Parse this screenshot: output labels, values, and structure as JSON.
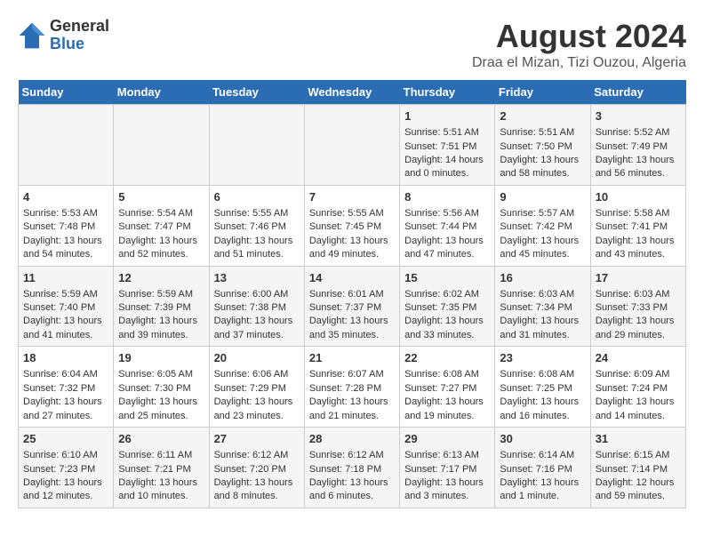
{
  "header": {
    "logo_general": "General",
    "logo_blue": "Blue",
    "month_title": "August 2024",
    "location": "Draa el Mizan, Tizi Ouzou, Algeria"
  },
  "days_of_week": [
    "Sunday",
    "Monday",
    "Tuesday",
    "Wednesday",
    "Thursday",
    "Friday",
    "Saturday"
  ],
  "weeks": [
    [
      {
        "day": "",
        "info": ""
      },
      {
        "day": "",
        "info": ""
      },
      {
        "day": "",
        "info": ""
      },
      {
        "day": "",
        "info": ""
      },
      {
        "day": "1",
        "info": "Sunrise: 5:51 AM\nSunset: 7:51 PM\nDaylight: 14 hours\nand 0 minutes."
      },
      {
        "day": "2",
        "info": "Sunrise: 5:51 AM\nSunset: 7:50 PM\nDaylight: 13 hours\nand 58 minutes."
      },
      {
        "day": "3",
        "info": "Sunrise: 5:52 AM\nSunset: 7:49 PM\nDaylight: 13 hours\nand 56 minutes."
      }
    ],
    [
      {
        "day": "4",
        "info": "Sunrise: 5:53 AM\nSunset: 7:48 PM\nDaylight: 13 hours\nand 54 minutes."
      },
      {
        "day": "5",
        "info": "Sunrise: 5:54 AM\nSunset: 7:47 PM\nDaylight: 13 hours\nand 52 minutes."
      },
      {
        "day": "6",
        "info": "Sunrise: 5:55 AM\nSunset: 7:46 PM\nDaylight: 13 hours\nand 51 minutes."
      },
      {
        "day": "7",
        "info": "Sunrise: 5:55 AM\nSunset: 7:45 PM\nDaylight: 13 hours\nand 49 minutes."
      },
      {
        "day": "8",
        "info": "Sunrise: 5:56 AM\nSunset: 7:44 PM\nDaylight: 13 hours\nand 47 minutes."
      },
      {
        "day": "9",
        "info": "Sunrise: 5:57 AM\nSunset: 7:42 PM\nDaylight: 13 hours\nand 45 minutes."
      },
      {
        "day": "10",
        "info": "Sunrise: 5:58 AM\nSunset: 7:41 PM\nDaylight: 13 hours\nand 43 minutes."
      }
    ],
    [
      {
        "day": "11",
        "info": "Sunrise: 5:59 AM\nSunset: 7:40 PM\nDaylight: 13 hours\nand 41 minutes."
      },
      {
        "day": "12",
        "info": "Sunrise: 5:59 AM\nSunset: 7:39 PM\nDaylight: 13 hours\nand 39 minutes."
      },
      {
        "day": "13",
        "info": "Sunrise: 6:00 AM\nSunset: 7:38 PM\nDaylight: 13 hours\nand 37 minutes."
      },
      {
        "day": "14",
        "info": "Sunrise: 6:01 AM\nSunset: 7:37 PM\nDaylight: 13 hours\nand 35 minutes."
      },
      {
        "day": "15",
        "info": "Sunrise: 6:02 AM\nSunset: 7:35 PM\nDaylight: 13 hours\nand 33 minutes."
      },
      {
        "day": "16",
        "info": "Sunrise: 6:03 AM\nSunset: 7:34 PM\nDaylight: 13 hours\nand 31 minutes."
      },
      {
        "day": "17",
        "info": "Sunrise: 6:03 AM\nSunset: 7:33 PM\nDaylight: 13 hours\nand 29 minutes."
      }
    ],
    [
      {
        "day": "18",
        "info": "Sunrise: 6:04 AM\nSunset: 7:32 PM\nDaylight: 13 hours\nand 27 minutes."
      },
      {
        "day": "19",
        "info": "Sunrise: 6:05 AM\nSunset: 7:30 PM\nDaylight: 13 hours\nand 25 minutes."
      },
      {
        "day": "20",
        "info": "Sunrise: 6:06 AM\nSunset: 7:29 PM\nDaylight: 13 hours\nand 23 minutes."
      },
      {
        "day": "21",
        "info": "Sunrise: 6:07 AM\nSunset: 7:28 PM\nDaylight: 13 hours\nand 21 minutes."
      },
      {
        "day": "22",
        "info": "Sunrise: 6:08 AM\nSunset: 7:27 PM\nDaylight: 13 hours\nand 19 minutes."
      },
      {
        "day": "23",
        "info": "Sunrise: 6:08 AM\nSunset: 7:25 PM\nDaylight: 13 hours\nand 16 minutes."
      },
      {
        "day": "24",
        "info": "Sunrise: 6:09 AM\nSunset: 7:24 PM\nDaylight: 13 hours\nand 14 minutes."
      }
    ],
    [
      {
        "day": "25",
        "info": "Sunrise: 6:10 AM\nSunset: 7:23 PM\nDaylight: 13 hours\nand 12 minutes."
      },
      {
        "day": "26",
        "info": "Sunrise: 6:11 AM\nSunset: 7:21 PM\nDaylight: 13 hours\nand 10 minutes."
      },
      {
        "day": "27",
        "info": "Sunrise: 6:12 AM\nSunset: 7:20 PM\nDaylight: 13 hours\nand 8 minutes."
      },
      {
        "day": "28",
        "info": "Sunrise: 6:12 AM\nSunset: 7:18 PM\nDaylight: 13 hours\nand 6 minutes."
      },
      {
        "day": "29",
        "info": "Sunrise: 6:13 AM\nSunset: 7:17 PM\nDaylight: 13 hours\nand 3 minutes."
      },
      {
        "day": "30",
        "info": "Sunrise: 6:14 AM\nSunset: 7:16 PM\nDaylight: 13 hours\nand 1 minute."
      },
      {
        "day": "31",
        "info": "Sunrise: 6:15 AM\nSunset: 7:14 PM\nDaylight: 12 hours\nand 59 minutes."
      }
    ]
  ]
}
